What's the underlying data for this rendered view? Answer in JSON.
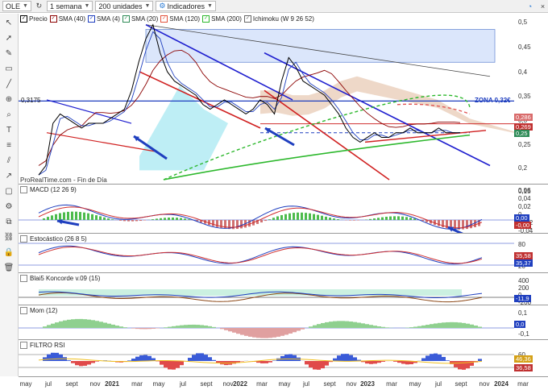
{
  "toolbar": {
    "symbol": "OLE",
    "period": "1 semana",
    "units": "200 unidades",
    "indicators": "Indicadores"
  },
  "left_tools": [
    "cursor-icon",
    "pointer-icon",
    "pencil-icon",
    "ruler-icon",
    "line-icon",
    "zoom-icon",
    "magnifier-icon",
    "text-icon",
    "fibonacci-icon",
    "channel-icon",
    "arrow-icon",
    "shape-icon",
    "gear-icon",
    "copy-icon",
    "link-icon",
    "lock-icon",
    "trash-icon"
  ],
  "price_panel": {
    "legend": [
      {
        "label": "Precio",
        "color": "#000000"
      },
      {
        "label": "SMA (40)",
        "color": "#8b0000"
      },
      {
        "label": "SMA (4)",
        "color": "#1f3fbf"
      },
      {
        "label": "SMA (20)",
        "color": "#2e8b57"
      },
      {
        "label": "SMA (120)",
        "color": "#e2513c"
      },
      {
        "label": "SMA (200)",
        "color": "#2db82d"
      },
      {
        "label": "Ichimoku (W 9 26 52)",
        "color": "#666666"
      }
    ],
    "level_label": "0,3175",
    "zone_label": "ZONA 0,32€",
    "source_label": "ProRealTime.com - Fin de Día",
    "y_ticks": [
      "0,5",
      "0,45",
      "0,4",
      "0,35",
      "0,3",
      "0,25",
      "0,2",
      "0,15"
    ],
    "badges": [
      {
        "text": "0,286",
        "color": "#d96b6b"
      },
      {
        "text": "0,269",
        "color": "#c03030"
      },
      {
        "text": "0,25",
        "color": "#2e8b57"
      }
    ]
  },
  "macd_panel": {
    "label": "MACD (12 26 9)",
    "y_ticks": [
      "0,06",
      "0,04",
      "0,02",
      "0",
      "-0,02",
      "-0,04"
    ],
    "badges": [
      {
        "text": "0,00",
        "color": "#1f3fbf"
      },
      {
        "text": "-0,00",
        "color": "#c03030"
      }
    ]
  },
  "stoch_panel": {
    "label": "Estocástico (26 8 5)",
    "y_ticks": [
      "80",
      "20"
    ],
    "badges": [
      {
        "text": "35,58",
        "color": "#c03030"
      },
      {
        "text": "35,37",
        "color": "#1f3fbf"
      }
    ]
  },
  "koncorde_panel": {
    "label": "Blai5 Koncorde v.09 (15)",
    "y_ticks": [
      "400",
      "200",
      "0",
      "-200"
    ],
    "badges": [
      {
        "text": "-11,9",
        "color": "#1f3fbf"
      }
    ]
  },
  "mom_panel": {
    "label": "Mom (12)",
    "y_ticks": [
      "0,1",
      "0",
      "-0,1"
    ],
    "badges": [
      {
        "text": "0,0",
        "color": "#1f3fbf"
      }
    ]
  },
  "rsi_panel": {
    "label": "FILTRO RSI",
    "y_ticks": [
      "60",
      "40"
    ],
    "badges": [
      {
        "text": "46,36",
        "color": "#d4a017"
      },
      {
        "text": "36,58",
        "color": "#c03030"
      }
    ]
  },
  "x_axis": [
    {
      "text": "may",
      "year": false
    },
    {
      "text": "jul",
      "year": false
    },
    {
      "text": "sept",
      "year": false
    },
    {
      "text": "nov",
      "year": false
    },
    {
      "text": "2021",
      "year": true
    },
    {
      "text": "mar",
      "year": false
    },
    {
      "text": "may",
      "year": false
    },
    {
      "text": "jul",
      "year": false
    },
    {
      "text": "sept",
      "year": false
    },
    {
      "text": "nov",
      "year": false
    },
    {
      "text": "2022",
      "year": true
    },
    {
      "text": "mar",
      "year": false
    },
    {
      "text": "may",
      "year": false
    },
    {
      "text": "jul",
      "year": false
    },
    {
      "text": "sept",
      "year": false
    },
    {
      "text": "nov",
      "year": false
    },
    {
      "text": "2023",
      "year": true
    },
    {
      "text": "mar",
      "year": false
    },
    {
      "text": "may",
      "year": false
    },
    {
      "text": "jul",
      "year": false
    },
    {
      "text": "sept",
      "year": false
    },
    {
      "text": "nov",
      "year": false
    },
    {
      "text": "2024",
      "year": true
    },
    {
      "text": "mar",
      "year": false
    }
  ],
  "chart_data": {
    "type": "line",
    "y_range_price": [
      0.15,
      0.5
    ],
    "price_weekly_approx": [
      0.16,
      0.18,
      0.27,
      0.29,
      0.28,
      0.27,
      0.26,
      0.27,
      0.27,
      0.27,
      0.28,
      0.29,
      0.3,
      0.34,
      0.4,
      0.45,
      0.48,
      0.42,
      0.38,
      0.36,
      0.35,
      0.34,
      0.33,
      0.31,
      0.3,
      0.31,
      0.32,
      0.31,
      0.3,
      0.29,
      0.3,
      0.32,
      0.31,
      0.29,
      0.36,
      0.41,
      0.39,
      0.36,
      0.35,
      0.34,
      0.33,
      0.31,
      0.29,
      0.26,
      0.24,
      0.23,
      0.24,
      0.25,
      0.24,
      0.24,
      0.25,
      0.25,
      0.26,
      0.25,
      0.25,
      0.25,
      0.26,
      0.25,
      0.25,
      0.25
    ]
  }
}
